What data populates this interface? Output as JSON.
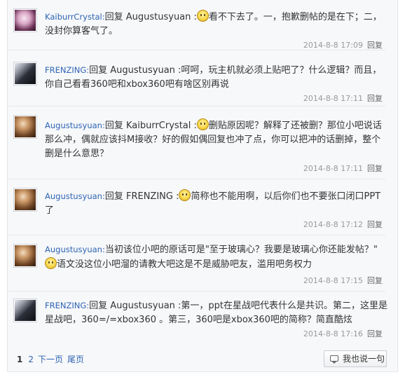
{
  "replies": [
    {
      "user": "KaiburrCrystal:",
      "pre": "回复 Augustusyuan :",
      "post": "看不下去了。一，抱歉删帖的是在下；二，没封你算客气了。",
      "time": "2014-8-8 17:09",
      "reply": "回复",
      "avatar": "anime-girl-pink"
    },
    {
      "user": "FRENZING:",
      "pre": "回复 Augustusyuan :呵呵，玩主机就必须上贴吧了？什么逻辑？而且，你自己看看360吧和xbox360吧有啥区别再说",
      "post": "",
      "time": "2014-8-8 17:11",
      "reply": "回复",
      "avatar": "dark-character"
    },
    {
      "user": "Augustusyuan:",
      "pre": "回复 KaiburrCrystal :",
      "post": "删贴原因呢？解释了还被删？那位小吧说话那么冲，偶就应该抖M接收？好的假如偶回复也冲了点，你可以把冲的话删掉，整个删是什么意思？",
      "time": "2014-8-8 17:11",
      "reply": "回复",
      "avatar": "brown-character"
    },
    {
      "user": "Augustusyuan:",
      "pre": "回复 FRENZING :",
      "post": "简称也不能用啊，以后你们也不要张口闭口PPT了",
      "time": "2014-8-8 17:12",
      "reply": "回复",
      "avatar": "brown-character"
    },
    {
      "user": "Augustusyuan:",
      "pre": "当初该位小吧的原话可是\"至于玻璃心？我要是玻璃心你还能发帖？\"",
      "post": "语文没这位小吧溜的请教大吧这是不是威胁吧友，滥用吧务权力",
      "time": "2014-8-8 17:15",
      "reply": "回复",
      "avatar": "brown-character"
    },
    {
      "user": "FRENZING:",
      "pre": "回复 Augustusyuan :第一，ppt在星战吧代表什么是共识。第二，这里是星战吧，360=/=xbox360 。第三，360吧是xbox360吧的简称？简直酷炫",
      "post": "",
      "time": "2014-8-8 17:16",
      "reply": "回复",
      "avatar": "dark-character"
    }
  ],
  "pager": {
    "current": "1",
    "page2": "2",
    "next": "下一页",
    "last": "尾页"
  },
  "say_button": {
    "label": "我也说一句",
    "icon": "speech-bubble-icon"
  }
}
